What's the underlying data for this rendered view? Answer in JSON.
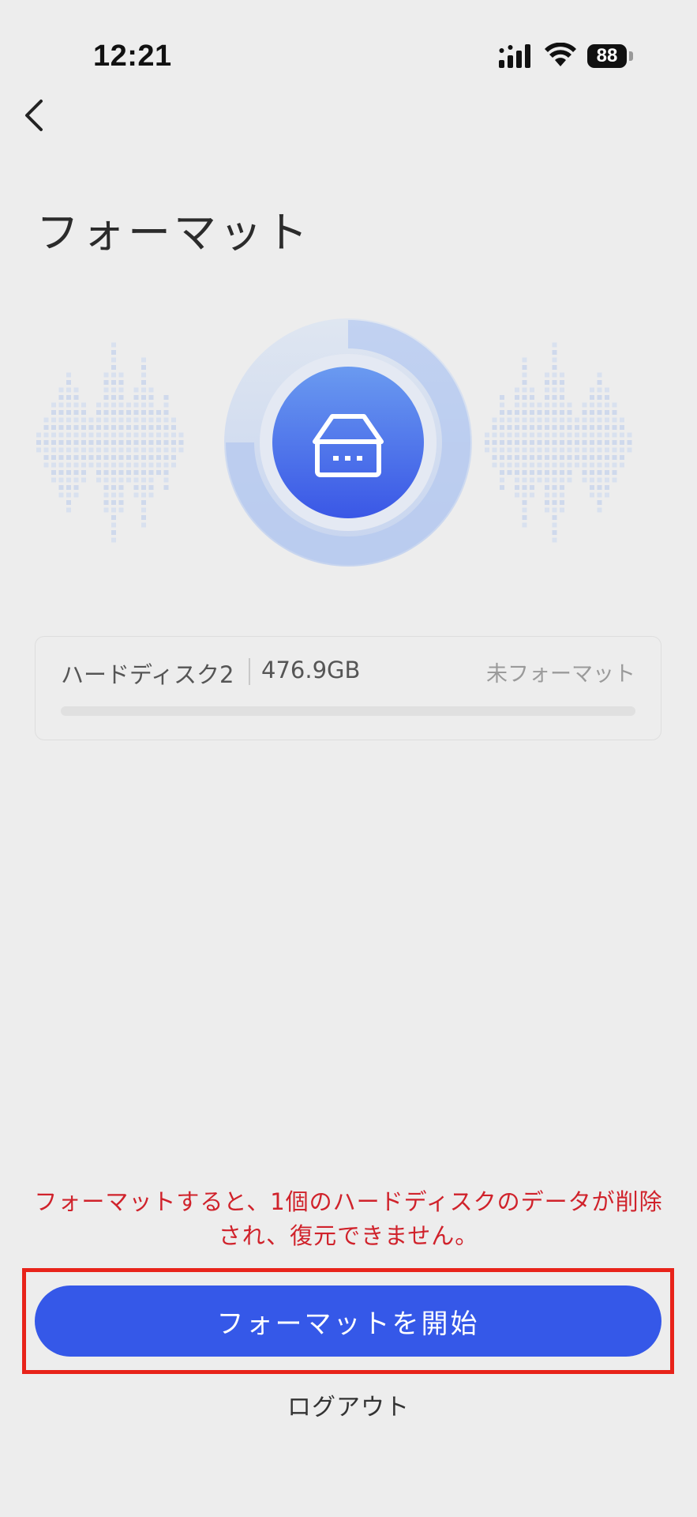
{
  "status_bar": {
    "time": "12:21",
    "battery_level": "88",
    "signal_icon": "cellular-signal-icon",
    "wifi_icon": "wifi-icon"
  },
  "nav": {
    "back_icon": "chevron-left-icon"
  },
  "page": {
    "title": "フォーマット"
  },
  "hero": {
    "icon": "hard-disk-icon",
    "accent_color": "#3558e8"
  },
  "disk": {
    "name": "ハードディスク2",
    "size": "476.9GB",
    "status": "未フォーマット",
    "progress": 0
  },
  "warning": {
    "text": "フォーマットすると、1個のハードディスクのデータが削除され、復元できません。",
    "color": "#d0222b"
  },
  "actions": {
    "start_label": "フォーマットを開始",
    "logout_label": "ログアウト"
  },
  "colors": {
    "background": "#ededed",
    "primary": "#3558e8",
    "highlight_border": "#e8231a"
  }
}
